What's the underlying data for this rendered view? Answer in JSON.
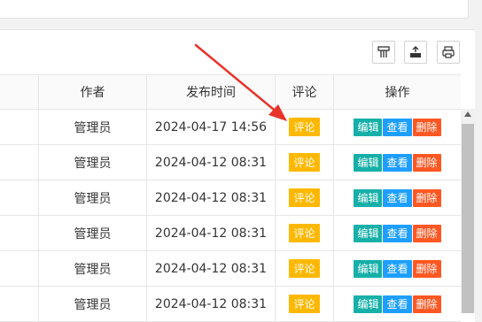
{
  "table": {
    "headers": {
      "author": "作者",
      "published": "发布时间",
      "comment": "评论",
      "actions": "操作"
    },
    "rows": [
      {
        "author": "管理员",
        "published": "2024-04-17 14:56"
      },
      {
        "author": "管理员",
        "published": "2024-04-12 08:31"
      },
      {
        "author": "管理员",
        "published": "2024-04-12 08:31"
      },
      {
        "author": "管理员",
        "published": "2024-04-12 08:31"
      },
      {
        "author": "管理员",
        "published": "2024-04-12 08:31"
      },
      {
        "author": "管理员",
        "published": "2024-04-12 08:31"
      }
    ],
    "buttons": {
      "comment": "评论",
      "edit": "编辑",
      "view": "查看",
      "delete": "删除"
    }
  },
  "toolbar": {
    "icons": [
      "columns-filter-icon",
      "export-icon",
      "print-icon"
    ]
  },
  "colors": {
    "comment_button": "#ffb800",
    "edit_button": "#16b0a8",
    "view_button": "#1e9fff",
    "delete_button": "#ff5722",
    "annotation_arrow": "#e8332a"
  }
}
